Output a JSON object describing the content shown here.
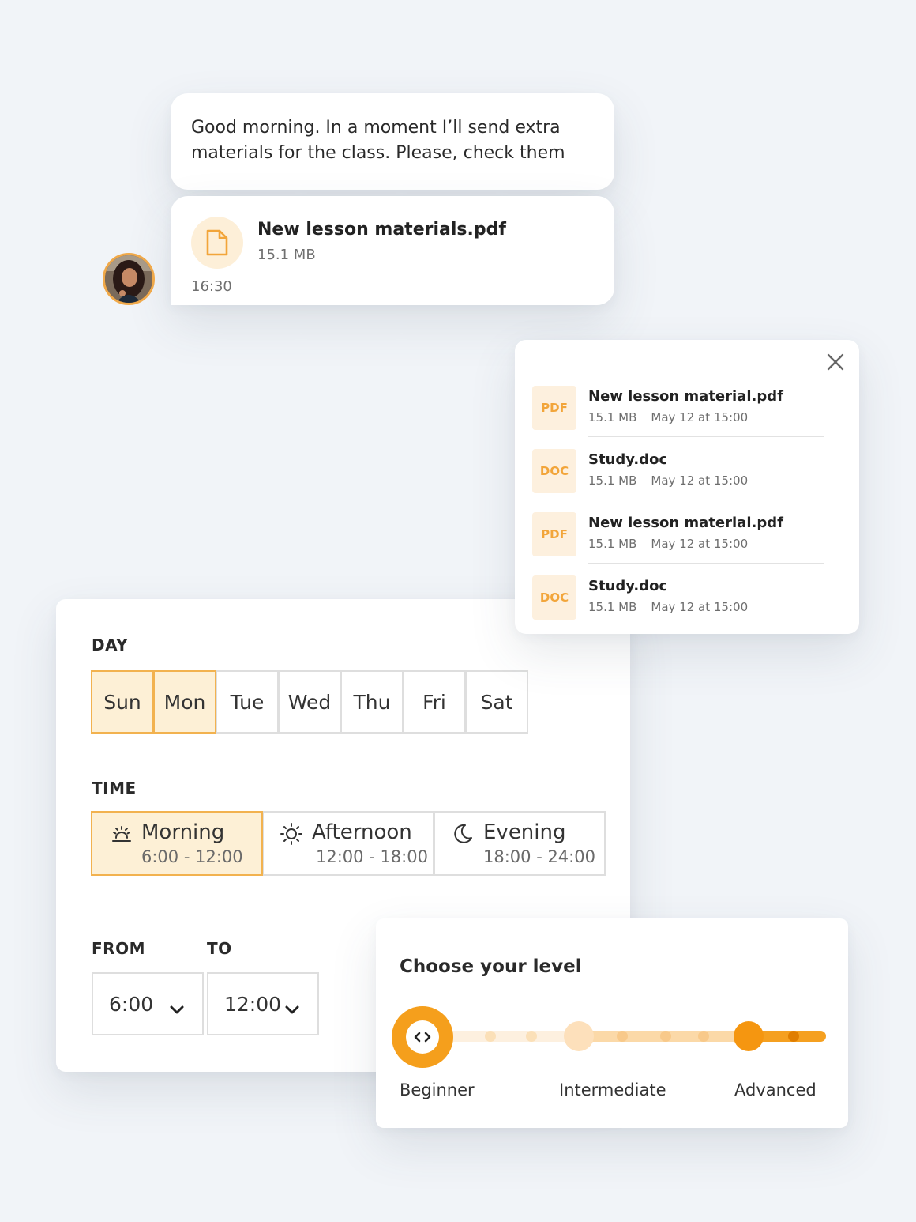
{
  "chat": {
    "message": "Good morning. In a moment I’ll send extra materials for the class. Please, check them",
    "attachment": {
      "name": "New lesson materials.pdf",
      "size": "15.1 MB",
      "time": "16:30"
    }
  },
  "files": [
    {
      "tag": "PDF",
      "name": "New lesson material.pdf",
      "size": "15.1 MB",
      "date": "May 12 at 15:00"
    },
    {
      "tag": "DOC",
      "name": "Study.doc",
      "size": "15.1 MB",
      "date": "May 12 at 15:00"
    },
    {
      "tag": "PDF",
      "name": "New lesson material.pdf",
      "size": "15.1 MB",
      "date": "May 12 at 15:00"
    },
    {
      "tag": "DOC",
      "name": "Study.doc",
      "size": "15.1 MB",
      "date": "May 12 at 15:00"
    }
  ],
  "schedule": {
    "day_label": "DAY",
    "days": [
      "Sun",
      "Mon",
      "Tue",
      "Wed",
      "Thu",
      "Fri",
      "Sat"
    ],
    "selected_days": [
      "Sun",
      "Mon"
    ],
    "time_label": "TIME",
    "slots": [
      {
        "name": "Morning",
        "range": "6:00 - 12:00",
        "icon": "sunrise-icon",
        "selected": true
      },
      {
        "name": "Afternoon",
        "range": "12:00 - 18:00",
        "icon": "sun-icon",
        "selected": false
      },
      {
        "name": "Evening",
        "range": "18:00 - 24:00",
        "icon": "moon-icon",
        "selected": false
      }
    ],
    "from_label": "FROM",
    "to_label": "TO",
    "from_value": "6:00",
    "to_value": "12:00"
  },
  "level": {
    "title": "Choose your level",
    "levels": [
      "Beginner",
      "Intermediate",
      "Advanced"
    ],
    "selected": "Beginner"
  },
  "colors": {
    "accent": "#f59a10",
    "accent_light": "#fdf0d6",
    "selected_border": "#f2b24f"
  }
}
